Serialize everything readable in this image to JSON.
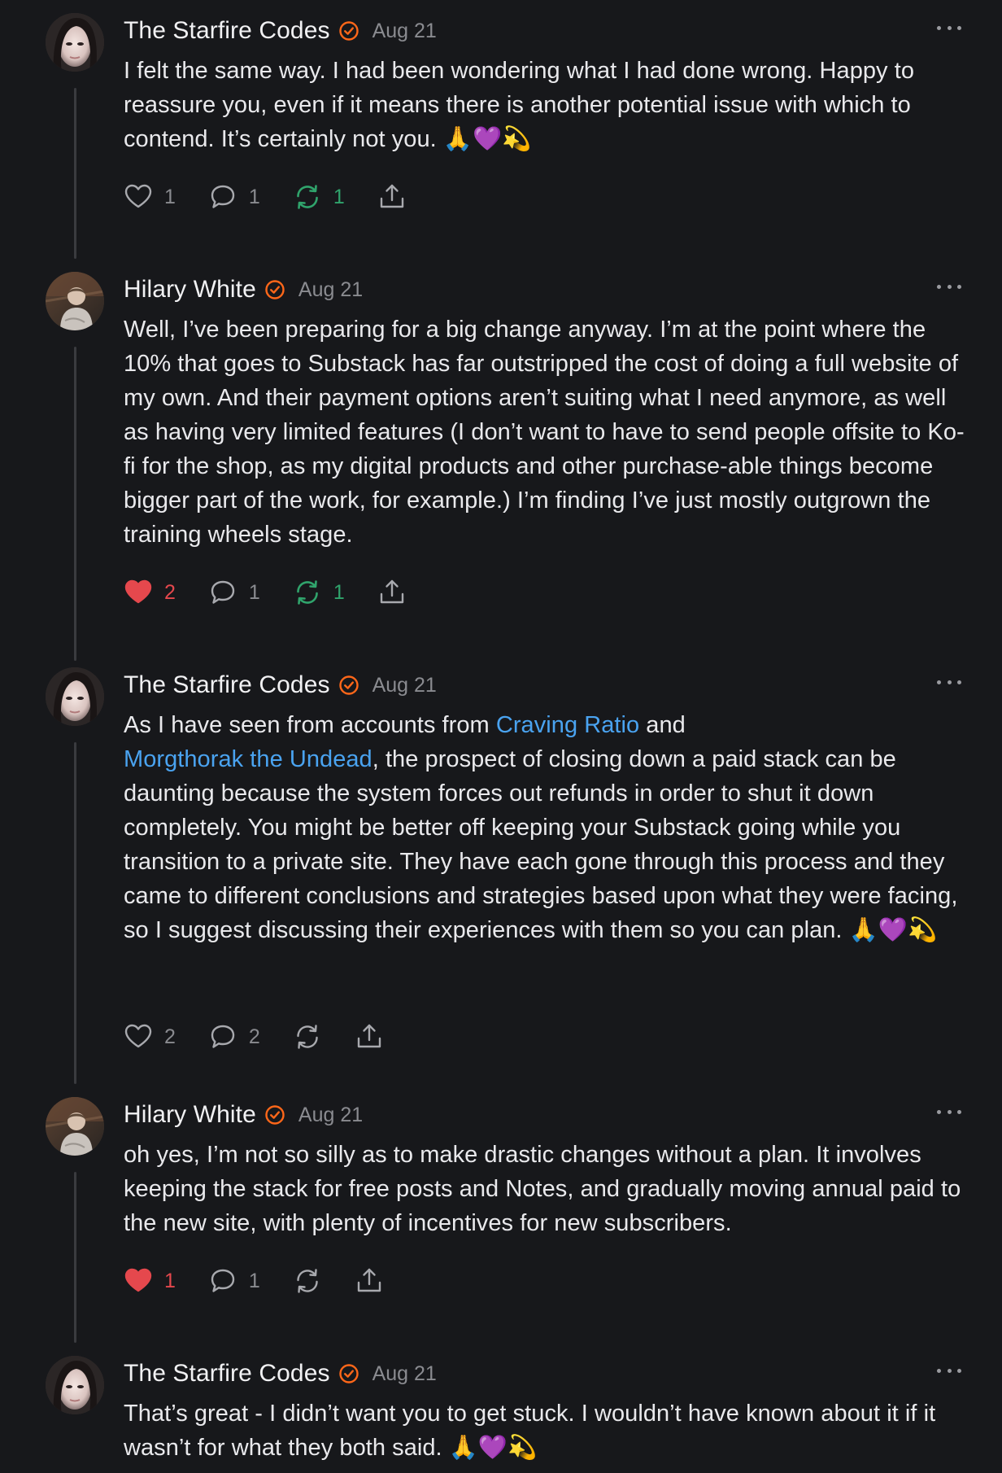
{
  "comments": [
    {
      "author": "The Starfire Codes",
      "date": "Aug 21",
      "text_parts": [
        "I felt the same way. I had been wondering what I had done wrong. Happy to reassure you, even if it means there is another potential issue with which to contend. It’s certainly not you. 🙏💜💫"
      ],
      "likes": "1",
      "liked": false,
      "replies": "1",
      "restacks": "1",
      "restacked": true
    },
    {
      "author": "Hilary White",
      "date": "Aug 21",
      "text_parts": [
        "Well, I’ve been preparing for a big change anyway. I’m at the point where the 10% that goes to Substack has far outstripped the cost of doing a full website of my own. And their payment options aren’t suiting what I need anymore, as well as having very limited features (I don’t want to have to send people offsite to Ko-fi for the shop, as my digital products and other purchase-able things become bigger part of the work, for example.) I’m finding I’ve just mostly outgrown the training wheels stage."
      ],
      "likes": "2",
      "liked": true,
      "replies": "1",
      "restacks": "1",
      "restacked": true
    },
    {
      "author": "The Starfire Codes",
      "date": "Aug 21",
      "text_before": "As I have seen from accounts from ",
      "link1": "Craving Ratio",
      "text_mid": " and ",
      "link2": "Morgthorak the Undead",
      "text_after": ", the prospect of closing down a paid stack can be daunting because the system forces out refunds in order to shut it down completely. You might be better off keeping your Substack going while you transition to a private site. They have each gone through this process and they came to different conclusions and strategies based upon what they were facing, so I suggest discussing their experiences with them so you can plan. 🙏💜💫",
      "likes": "2",
      "liked": false,
      "replies": "2",
      "restacks": "",
      "restacked": false
    },
    {
      "author": "Hilary White",
      "date": "Aug 21",
      "text_parts": [
        "oh yes, I’m not so silly as to make drastic changes without a plan. It involves keeping the stack for free posts and Notes, and gradually moving annual paid to the new site, with plenty of incentives for new subscribers."
      ],
      "likes": "1",
      "liked": true,
      "replies": "1",
      "restacks": "",
      "restacked": false
    },
    {
      "author": "The Starfire Codes",
      "date": "Aug 21",
      "text_parts": [
        "That’s great - I didn’t want you to get stuck. I wouldn’t have known about it if it wasn’t for what they both said. 🙏💜💫"
      ]
    }
  ],
  "icons": {
    "like": "heart-icon",
    "reply": "comment-bubble-icon",
    "restack": "restack-icon",
    "share": "share-icon",
    "verified": "verified-check-icon",
    "more": "more-dots-icon"
  },
  "colors": {
    "background": "#17181b",
    "verified": "#ff6719",
    "link": "#4aa3f0",
    "liked": "#e5484d",
    "restacked": "#30a46c",
    "muted": "#8a8b90"
  }
}
